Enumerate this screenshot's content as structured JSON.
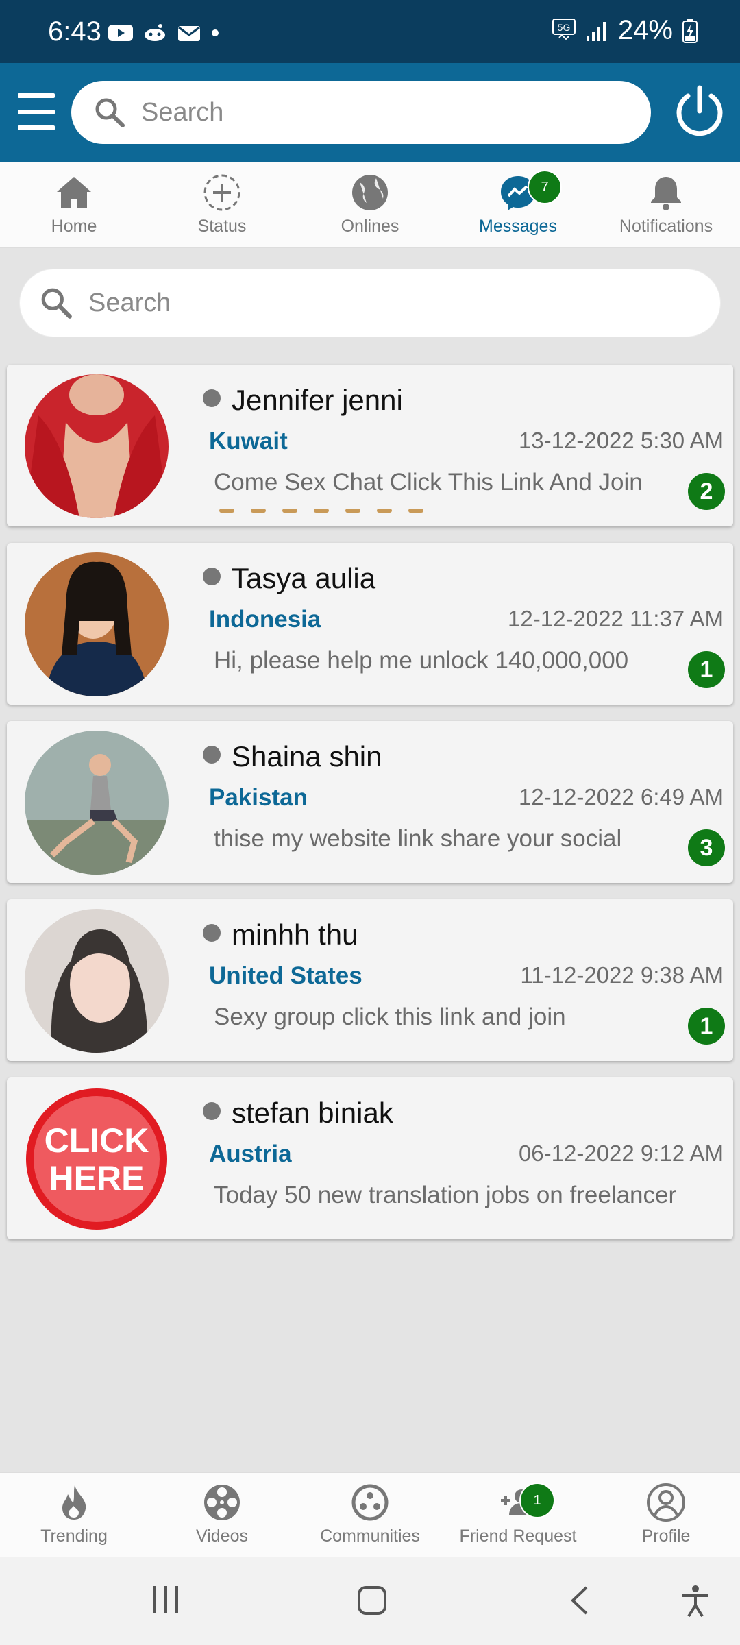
{
  "status_bar": {
    "time": "6:43",
    "network": "5G",
    "battery": "24%"
  },
  "app_bar": {
    "search_placeholder": "Search"
  },
  "top_tabs": [
    {
      "label": "Home",
      "icon": "home-icon"
    },
    {
      "label": "Status",
      "icon": "add-status-icon"
    },
    {
      "label": "Onlines",
      "icon": "globe-icon"
    },
    {
      "label": "Messages",
      "icon": "messenger-icon",
      "badge": "7",
      "active": true
    },
    {
      "label": "Notifications",
      "icon": "bell-icon"
    }
  ],
  "messages_search": {
    "placeholder": "Search"
  },
  "conversations": [
    {
      "name": "Jennifer jenni",
      "country": "Kuwait",
      "date": "13-12-2022 5:30 AM",
      "preview": "Come Sex Chat Click This Link And Join",
      "unread": "2"
    },
    {
      "name": "Tasya aulia",
      "country": "Indonesia",
      "date": "12-12-2022 11:37 AM",
      "preview": "Hi, please help me unlock 140,000,000",
      "unread": "1"
    },
    {
      "name": "Shaina shin",
      "country": "Pakistan",
      "date": "12-12-2022 6:49 AM",
      "preview": "thise my website link share your social",
      "unread": "3"
    },
    {
      "name": "minhh thu",
      "country": "United States",
      "date": "11-12-2022 9:38 AM",
      "preview": "Sexy group click this link and join",
      "unread": "1"
    },
    {
      "name": "stefan biniak",
      "country": "Austria",
      "date": "06-12-2022 9:12 AM",
      "preview": "Today 50 new translation jobs on freelancer",
      "avatar_text_line1": "CLICK",
      "avatar_text_line2": "HERE"
    }
  ],
  "bottom_nav": [
    {
      "label": "Trending",
      "icon": "flame-icon"
    },
    {
      "label": "Videos",
      "icon": "film-reel-icon"
    },
    {
      "label": "Communities",
      "icon": "communities-icon"
    },
    {
      "label": "Friend Request",
      "icon": "add-friend-icon",
      "badge": "1"
    },
    {
      "label": "Profile",
      "icon": "profile-icon"
    }
  ],
  "colors": {
    "status_bar": "#0b3d5e",
    "app_bar": "#0d6896",
    "accent": "#0d6896",
    "badge": "#0f7a16"
  }
}
